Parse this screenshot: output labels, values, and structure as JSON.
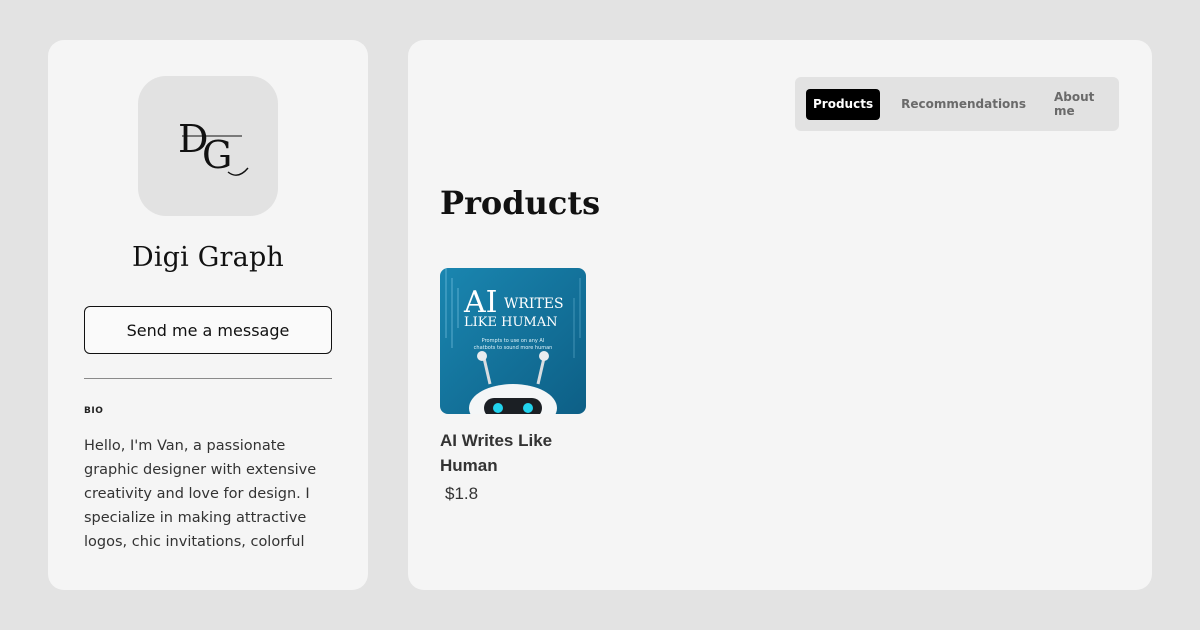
{
  "profile": {
    "logo_text": "DG",
    "store_name": "Digi Graph",
    "message_button": "Send me a message",
    "bio_label": "BIO",
    "bio_text": "Hello, I'm Van, a passionate graphic designer with extensive creativity and love for design. I specialize in making attractive logos, chic invitations, colorful"
  },
  "nav": {
    "tabs": [
      {
        "label": "Products",
        "active": true
      },
      {
        "label": "Recommendations",
        "active": false
      },
      {
        "label": "About me",
        "active": false
      }
    ]
  },
  "main": {
    "section_title": "Products",
    "products": [
      {
        "name": "AI Writes Like Human",
        "price": "$1.8",
        "thumb_title_big": "AI",
        "thumb_title_small": "WRITES",
        "thumb_title_line2": "LIKE HUMAN",
        "thumb_subtitle_1": "Prompts to use on any AI",
        "thumb_subtitle_2": "chatbots to sound more human"
      }
    ]
  },
  "colors": {
    "page_bg": "#e3e3e3",
    "card_bg": "#f5f5f5",
    "active_tab_bg": "#000000",
    "thumb_bg": "#1478a3",
    "robot_eye": "#22d3ee"
  },
  "icons": {
    "logo": "dg-monogram-logo",
    "thumbnail": "robot-illustration"
  }
}
